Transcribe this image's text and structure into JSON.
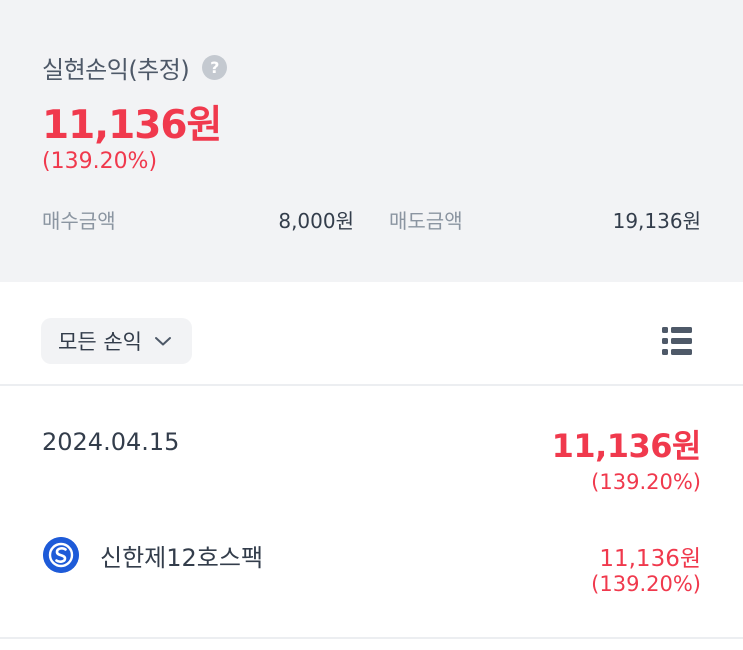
{
  "summary": {
    "title": "실현손익(추정)",
    "help_icon": "question-mark",
    "amount": "11,136원",
    "rate": "(139.20%)",
    "buy_label": "매수금액",
    "buy_value": "8,000원",
    "sell_label": "매도금액",
    "sell_value": "19,136원"
  },
  "filter": {
    "label": "모든 손익",
    "chevron_icon": "chevron-down",
    "list_icon": "list-view"
  },
  "day": {
    "date": "2024.04.15",
    "amount": "11,136원",
    "rate": "(139.20%)"
  },
  "stock": {
    "name": "신한제12호스팩",
    "amount": "11,136원",
    "rate": "(139.20%)",
    "logo_color": "#1e5bd8"
  },
  "colors": {
    "profit": "#f0394d",
    "background_panel": "#f2f3f5"
  }
}
